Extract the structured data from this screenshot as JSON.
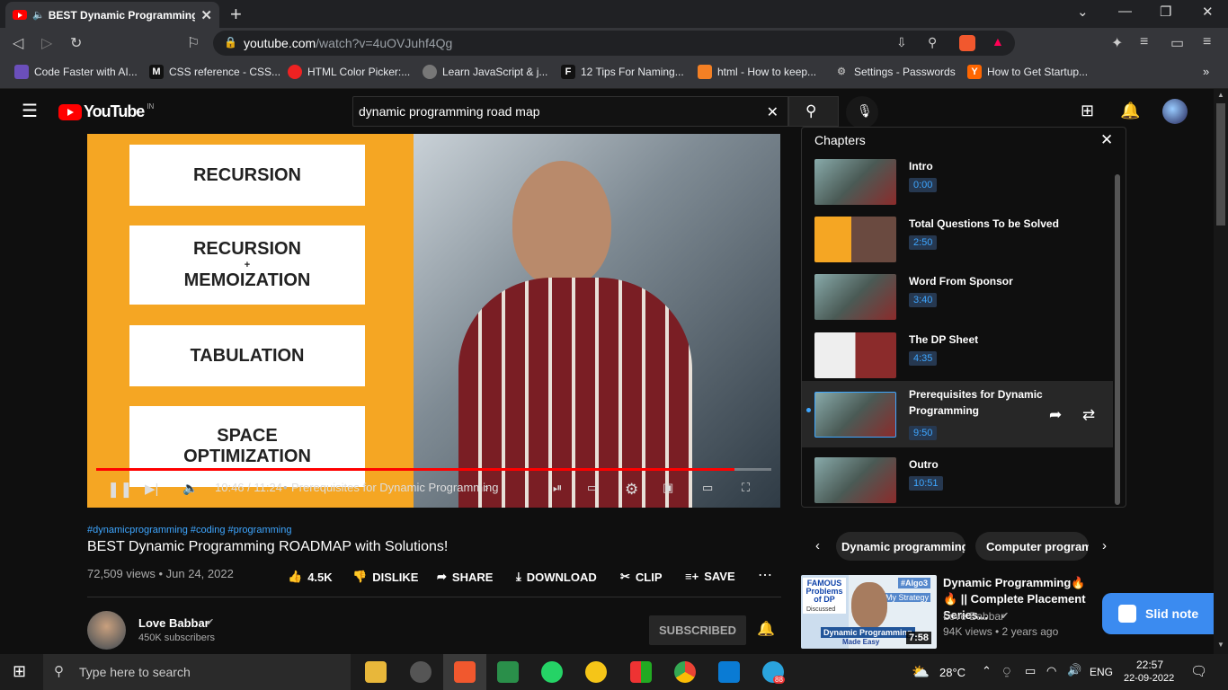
{
  "browser": {
    "tab_title": "BEST Dynamic Programming R",
    "url_host": "youtube.com",
    "url_path": "/watch?v=4uOVJuhf4Qg",
    "bookmarks": [
      {
        "label": "Code Faster with AI...",
        "icon": "ai-icon"
      },
      {
        "label": "CSS reference - CSS...",
        "icon": "mdn-icon"
      },
      {
        "label": "HTML Color Picker:...",
        "icon": "color-picker-icon"
      },
      {
        "label": "Learn JavaScript & j...",
        "icon": "globe-icon"
      },
      {
        "label": "12 Tips For Naming...",
        "icon": "f-icon"
      },
      {
        "label": "html - How to keep...",
        "icon": "stackoverflow-icon"
      },
      {
        "label": "Settings - Passwords",
        "icon": "gear-icon"
      },
      {
        "label": "How to Get Startup...",
        "icon": "ycombinator-icon"
      }
    ]
  },
  "youtube": {
    "logo": "YouTube",
    "logo_region": "IN",
    "search_value": "dynamic programming road map"
  },
  "video": {
    "slides": [
      "RECURSION",
      "RECURSION",
      "+",
      "MEMOIZATION",
      "TABULATION",
      "SPACE",
      "OPTIMIZATION"
    ],
    "time": "10:46 / 11:24",
    "chapter": "Prerequisites for Dynamic Programming",
    "progress": 0.945,
    "hashtags": "#dynamicprogramming #coding #programming",
    "title": "BEST Dynamic Programming ROADMAP with Solutions!",
    "views_date": "72,509 views • Jun 24, 2022",
    "likes": "4.5K",
    "dislike": "DISLIKE",
    "share": "SHARE",
    "download": "DOWNLOAD",
    "clip": "CLIP",
    "save": "SAVE",
    "channel": "Love Babbar",
    "subscribers": "450K subscribers",
    "subscribed": "SUBSCRIBED"
  },
  "chapters": {
    "header": "Chapters",
    "items": [
      {
        "title": "Intro",
        "time": "0:00"
      },
      {
        "title": "Total Questions To be Solved",
        "time": "2:50"
      },
      {
        "title": "Word From Sponsor",
        "time": "3:40"
      },
      {
        "title": "The DP Sheet",
        "time": "4:35"
      },
      {
        "title": "Prerequisites for Dynamic Programming",
        "time": "9:50"
      },
      {
        "title": "Outro",
        "time": "10:51"
      }
    ]
  },
  "chips": [
    "Dynamic programming",
    "Computer program"
  ],
  "recommended": {
    "title": "Dynamic Programming🔥🔥 || Complete Placement Series...",
    "channel": "Love Babbar",
    "meta": "94K views • 2 years ago",
    "duration": "7:58",
    "thumb_text1": "FAMOUS Problems of DP",
    "thumb_text2": "Discussed",
    "thumb_tag": "#Algo3",
    "thumb_strategy": "My Strategy",
    "thumb_bottom": "Dynamic Programming",
    "thumb_bottom2": "Made Easy"
  },
  "slid_note": "Slid note",
  "taskbar": {
    "search_placeholder": "Type here to search",
    "temperature": "28°C",
    "lang": "ENG",
    "time": "22:57",
    "date": "22-09-2022",
    "telegram_badge": "88"
  }
}
